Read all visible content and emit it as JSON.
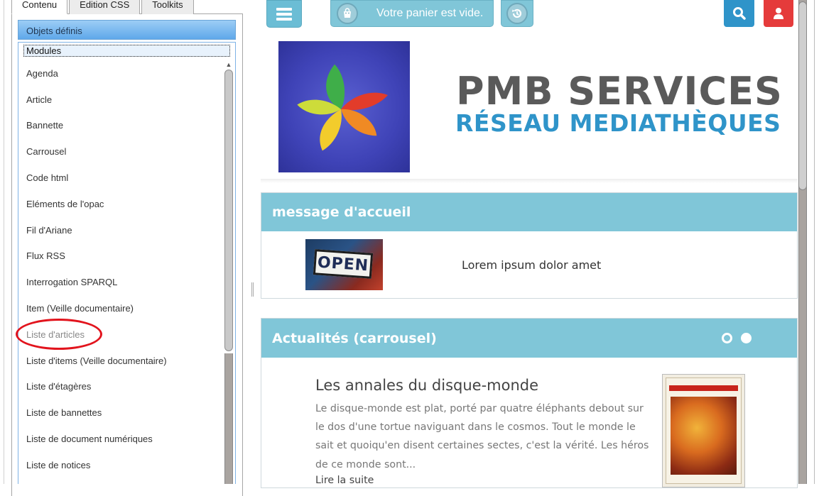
{
  "left_panel": {
    "tabs": [
      {
        "label": "Contenu",
        "active": true
      },
      {
        "label": "Edition CSS",
        "active": false
      },
      {
        "label": "Toolkits",
        "active": false
      }
    ],
    "section_header": "Objets définis",
    "modules_label": "Modules",
    "modules": [
      "Agenda",
      "Article",
      "Bannette",
      "Carrousel",
      "Code html",
      "Eléments de l'opac",
      "Fil d'Ariane",
      "Flux RSS",
      "Interrogation SPARQL",
      "Item (Veille documentaire)",
      "Liste d'articles",
      "Liste d'items (Veille documentaire)",
      "Liste d'étagères",
      "Liste de bannettes",
      "Liste de document numériques",
      "Liste de notices"
    ],
    "highlighted_module": "Liste d'articles",
    "highlight_color": "#e2141d"
  },
  "header": {
    "cart_text": "Votre panier est vide.",
    "menu_icon": "hamburger-icon",
    "cart_icon": "shopping-bag-icon",
    "history_icon": "history-icon",
    "search_icon": "search-icon",
    "user_icon": "user-icon",
    "colors": {
      "teal": "#80c6d8",
      "search": "#2f94c9",
      "user": "#e53b3b"
    }
  },
  "banner": {
    "title": "PMB SERVICES",
    "subtitle": "RÉSEAU MEDIATHÈQUES"
  },
  "welcome": {
    "heading": "message d'accueil",
    "image_sign": "OPEN",
    "text": "Lorem ipsum dolor amet"
  },
  "news": {
    "heading": "Actualités (carrousel)",
    "dots": 2,
    "article_title": "Les annales du disque-monde",
    "article_text": "Le disque-monde est plat, porté par quatre éléphants debout sur le dos d'une tortue naviguant dans le cosmos. Tout le monde le sait et quoiqu'en disent certaines sectes, c'est la vérité. Les héros de ce monde sont...",
    "read_more": "Lire la suite"
  }
}
